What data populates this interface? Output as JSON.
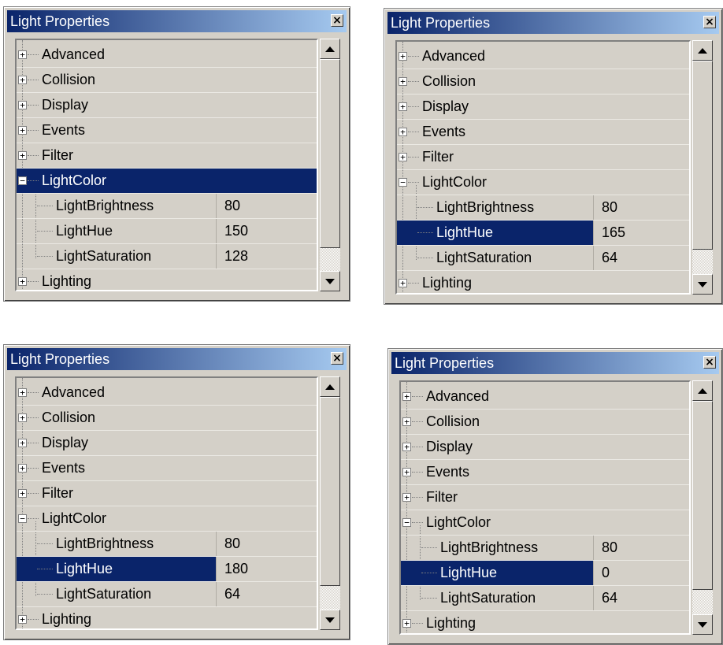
{
  "colors": {
    "selection": "#0a246a",
    "face": "#d4d0c8"
  },
  "panels": [
    {
      "title": "Light Properties",
      "close": "×",
      "selected": "LightColor",
      "rows": [
        {
          "label": "Advanced",
          "type": "group",
          "expander": "+"
        },
        {
          "label": "Collision",
          "type": "group",
          "expander": "+"
        },
        {
          "label": "Display",
          "type": "group",
          "expander": "+"
        },
        {
          "label": "Events",
          "type": "group",
          "expander": "+"
        },
        {
          "label": "Filter",
          "type": "group",
          "expander": "+"
        },
        {
          "label": "LightColor",
          "type": "group",
          "expander": "−"
        },
        {
          "label": "LightBrightness",
          "type": "prop",
          "value": "80"
        },
        {
          "label": "LightHue",
          "type": "prop",
          "value": "150"
        },
        {
          "label": "LightSaturation",
          "type": "prop",
          "value": "128"
        },
        {
          "label": "Lighting",
          "type": "group",
          "expander": "+"
        }
      ]
    },
    {
      "title": "Light Properties",
      "close": "×",
      "selected": "LightHue",
      "rows": [
        {
          "label": "Advanced",
          "type": "group",
          "expander": "+"
        },
        {
          "label": "Collision",
          "type": "group",
          "expander": "+"
        },
        {
          "label": "Display",
          "type": "group",
          "expander": "+"
        },
        {
          "label": "Events",
          "type": "group",
          "expander": "+"
        },
        {
          "label": "Filter",
          "type": "group",
          "expander": "+"
        },
        {
          "label": "LightColor",
          "type": "group",
          "expander": "−"
        },
        {
          "label": "LightBrightness",
          "type": "prop",
          "value": "80"
        },
        {
          "label": "LightHue",
          "type": "prop",
          "value": "165"
        },
        {
          "label": "LightSaturation",
          "type": "prop",
          "value": "64"
        },
        {
          "label": "Lighting",
          "type": "group",
          "expander": "+"
        }
      ]
    },
    {
      "title": "Light Properties",
      "close": "×",
      "selected": "LightHue",
      "rows": [
        {
          "label": "Advanced",
          "type": "group",
          "expander": "+"
        },
        {
          "label": "Collision",
          "type": "group",
          "expander": "+"
        },
        {
          "label": "Display",
          "type": "group",
          "expander": "+"
        },
        {
          "label": "Events",
          "type": "group",
          "expander": "+"
        },
        {
          "label": "Filter",
          "type": "group",
          "expander": "+"
        },
        {
          "label": "LightColor",
          "type": "group",
          "expander": "−"
        },
        {
          "label": "LightBrightness",
          "type": "prop",
          "value": "80"
        },
        {
          "label": "LightHue",
          "type": "prop",
          "value": "180"
        },
        {
          "label": "LightSaturation",
          "type": "prop",
          "value": "64"
        },
        {
          "label": "Lighting",
          "type": "group",
          "expander": "+"
        }
      ]
    },
    {
      "title": "Light Properties",
      "close": "×",
      "selected": "LightHue",
      "rows": [
        {
          "label": "Advanced",
          "type": "group",
          "expander": "+"
        },
        {
          "label": "Collision",
          "type": "group",
          "expander": "+"
        },
        {
          "label": "Display",
          "type": "group",
          "expander": "+"
        },
        {
          "label": "Events",
          "type": "group",
          "expander": "+"
        },
        {
          "label": "Filter",
          "type": "group",
          "expander": "+"
        },
        {
          "label": "LightColor",
          "type": "group",
          "expander": "−"
        },
        {
          "label": "LightBrightness",
          "type": "prop",
          "value": "80"
        },
        {
          "label": "LightHue",
          "type": "prop",
          "value": "0"
        },
        {
          "label": "LightSaturation",
          "type": "prop",
          "value": "64"
        },
        {
          "label": "Lighting",
          "type": "group",
          "expander": "+"
        }
      ]
    }
  ]
}
